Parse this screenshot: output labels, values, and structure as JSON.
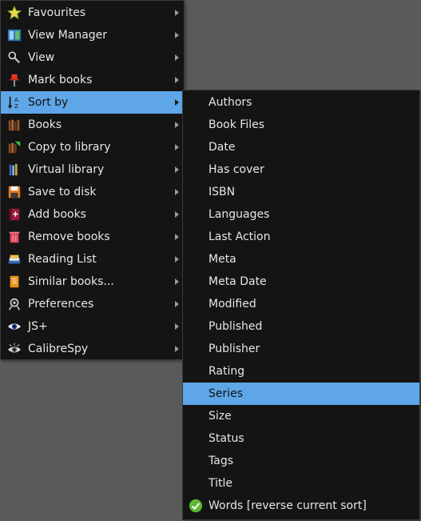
{
  "main_menu": {
    "items": [
      {
        "label": "Favourites",
        "icon": "star-icon"
      },
      {
        "label": "View Manager",
        "icon": "view-manager-icon"
      },
      {
        "label": "View",
        "icon": "magnifier-icon"
      },
      {
        "label": "Mark books",
        "icon": "pushpin-icon"
      },
      {
        "label": "Sort by",
        "icon": "sort-az-icon",
        "active": true
      },
      {
        "label": "Books",
        "icon": "books-icon"
      },
      {
        "label": "Copy to library",
        "icon": "copy-library-icon"
      },
      {
        "label": "Virtual library",
        "icon": "virtual-library-icon"
      },
      {
        "label": "Save to disk",
        "icon": "floppy-disk-icon"
      },
      {
        "label": "Add books",
        "icon": "add-book-icon"
      },
      {
        "label": "Remove books",
        "icon": "trash-icon"
      },
      {
        "label": "Reading List",
        "icon": "reading-list-icon"
      },
      {
        "label": "Similar books...",
        "icon": "similar-books-icon"
      },
      {
        "label": "Preferences",
        "icon": "preferences-icon"
      },
      {
        "label": "JS+",
        "icon": "eye-icon"
      },
      {
        "label": "CalibreSpy",
        "icon": "spy-eye-icon"
      }
    ]
  },
  "sort_menu": {
    "items": [
      {
        "label": "Authors"
      },
      {
        "label": "Book Files"
      },
      {
        "label": "Date"
      },
      {
        "label": "Has cover"
      },
      {
        "label": "ISBN"
      },
      {
        "label": "Languages"
      },
      {
        "label": "Last Action"
      },
      {
        "label": "Meta"
      },
      {
        "label": "Meta Date"
      },
      {
        "label": "Modified"
      },
      {
        "label": "Published"
      },
      {
        "label": "Publisher"
      },
      {
        "label": "Rating"
      },
      {
        "label": "Series",
        "active": true
      },
      {
        "label": "Size"
      },
      {
        "label": "Status"
      },
      {
        "label": "Tags"
      },
      {
        "label": "Title"
      },
      {
        "label": "Words [reverse current sort]",
        "checked": true
      }
    ]
  },
  "colors": {
    "menu_bg": "#141414",
    "highlight": "#5fa6e8",
    "desktop_bg": "#5a5a5a",
    "text": "#e6e6e6"
  }
}
